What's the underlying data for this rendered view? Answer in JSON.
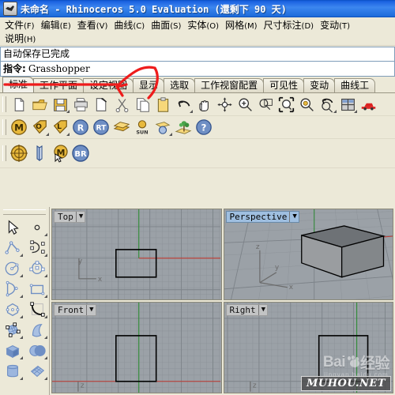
{
  "window": {
    "title": "未命名 - Rhinoceros 5.0 Evaluation (還剩下 90 天)",
    "icon": "rhino-app-icon"
  },
  "menubar": {
    "row1": [
      {
        "label": "文件",
        "key": "(F)"
      },
      {
        "label": "编辑",
        "key": "(E)"
      },
      {
        "label": "查看",
        "key": "(V)"
      },
      {
        "label": "曲线",
        "key": "(C)"
      },
      {
        "label": "曲面",
        "key": "(S)"
      },
      {
        "label": "实体",
        "key": "(O)"
      },
      {
        "label": "网格",
        "key": "(M)"
      },
      {
        "label": "尺寸标注",
        "key": "(D)"
      },
      {
        "label": "变动",
        "key": "(T)"
      }
    ],
    "row2": [
      {
        "label": "说明",
        "key": "(H)"
      }
    ]
  },
  "command": {
    "history": "自动保存已完成",
    "prompt_label": "指令:",
    "prompt_value": "Grasshopper"
  },
  "tabs": [
    {
      "label": "标准",
      "active": true
    },
    {
      "label": "工作平面",
      "active": false
    },
    {
      "label": "设定视图",
      "active": false
    },
    {
      "label": "显示",
      "active": false
    },
    {
      "label": "选取",
      "active": false
    },
    {
      "label": "工作视窗配置",
      "active": false
    },
    {
      "label": "可见性",
      "active": false
    },
    {
      "label": "变动",
      "active": false
    },
    {
      "label": "曲线工",
      "active": false
    }
  ],
  "toolbar_standard": [
    {
      "icon": "new-file-icon",
      "corner": false
    },
    {
      "icon": "open-folder-icon",
      "corner": false
    },
    {
      "icon": "save-icon",
      "corner": true
    },
    {
      "icon": "print-icon",
      "corner": false
    },
    {
      "icon": "export-icon",
      "corner": false
    },
    {
      "icon": "cut-scissors-icon",
      "corner": false
    },
    {
      "icon": "copy-icon",
      "corner": false
    },
    {
      "icon": "paste-clipboard-icon",
      "corner": false
    },
    {
      "icon": "undo-arrow-icon",
      "corner": true
    },
    {
      "icon": "pan-hand-icon",
      "corner": false
    },
    {
      "icon": "rotate-view-icon",
      "corner": false
    },
    {
      "icon": "zoom-in-icon",
      "corner": false
    },
    {
      "icon": "zoom-window-icon",
      "corner": false
    },
    {
      "icon": "zoom-extents-icon",
      "corner": false
    },
    {
      "icon": "zoom-selected-icon",
      "corner": false
    },
    {
      "icon": "zoom-previous-icon",
      "corner": true
    },
    {
      "icon": "four-viewport-icon",
      "corner": true
    },
    {
      "icon": "render-car-icon",
      "corner": false
    }
  ],
  "toolbar_render": [
    {
      "icon": "materials-m-icon",
      "corner": false
    },
    {
      "icon": "object-properties-o-icon",
      "corner": true
    },
    {
      "icon": "layer-tag-icon",
      "corner": true
    },
    {
      "icon": "render-r-icon",
      "corner": false
    },
    {
      "icon": "render-rt-icon",
      "corner": false
    },
    {
      "icon": "mesh-planes-icon",
      "corner": false
    },
    {
      "icon": "sun-icon",
      "corner": false
    },
    {
      "icon": "environment-sphere-icon",
      "corner": true
    },
    {
      "icon": "ground-plane-plant-icon",
      "corner": false
    },
    {
      "icon": "help-question-icon",
      "corner": false
    }
  ],
  "toolbar_plugins": [
    {
      "icon": "gumball-target-icon",
      "corner": false
    },
    {
      "icon": "mirror-panel-icon",
      "corner": false
    },
    {
      "icon": "m-cursor-icon",
      "corner": false
    },
    {
      "icon": "br-block-icon",
      "corner": false
    }
  ],
  "sidebar_tools": [
    {
      "icon": "select-arrow-icon",
      "corner": false
    },
    {
      "icon": "point-icon",
      "corner": true
    },
    {
      "icon": "polyline-icon",
      "corner": true
    },
    {
      "icon": "control-point-curve-icon",
      "corner": true
    },
    {
      "icon": "circle-icon",
      "corner": true
    },
    {
      "icon": "ellipse-icon",
      "corner": true
    },
    {
      "icon": "arc-icon",
      "corner": true
    },
    {
      "icon": "rectangle-icon",
      "corner": true
    },
    {
      "icon": "polygon-icon",
      "corner": true
    },
    {
      "icon": "curve-fillet-icon",
      "corner": true
    },
    {
      "icon": "surface-control-points-icon",
      "corner": true
    },
    {
      "icon": "surface-sweep-icon",
      "corner": true
    },
    {
      "icon": "box-solid-icon",
      "corner": true
    },
    {
      "icon": "sphere-boolean-icon",
      "corner": true
    },
    {
      "icon": "cylinder-icon",
      "corner": true
    },
    {
      "icon": "mesh-surface-icon",
      "corner": true
    }
  ],
  "viewports": [
    {
      "name": "Top",
      "active": false,
      "axes": [
        "y",
        "x"
      ],
      "objects": [
        "rectangle"
      ]
    },
    {
      "name": "Perspective",
      "active": true,
      "axes": [
        "z",
        "y",
        "x"
      ],
      "objects": [
        "shaded-box"
      ]
    },
    {
      "name": "Front",
      "active": false,
      "axes": [
        "z"
      ],
      "objects": [
        "rectangle"
      ]
    },
    {
      "name": "Right",
      "active": false,
      "axes": [
        "z"
      ],
      "objects": [
        "rectangle"
      ]
    }
  ],
  "watermarks": {
    "baidu_main": "Bai",
    "baidu_paw": "du",
    "baidu_cn": "经验",
    "baidu_sub": "jingyan.baidu.com",
    "muhou": "MUHOU.NET"
  },
  "annotation": {
    "type": "red-arrow",
    "color": "#ee1c1c",
    "description": "red underline and curved arrow pointing at command line"
  },
  "colors": {
    "titlebar": "#1b62e0",
    "chrome": "#ece9d8",
    "viewport_bg": "#9aa0a6",
    "axis_x": "#c83232",
    "axis_y": "#3c8c3c",
    "accent": "#ee1c1c"
  }
}
